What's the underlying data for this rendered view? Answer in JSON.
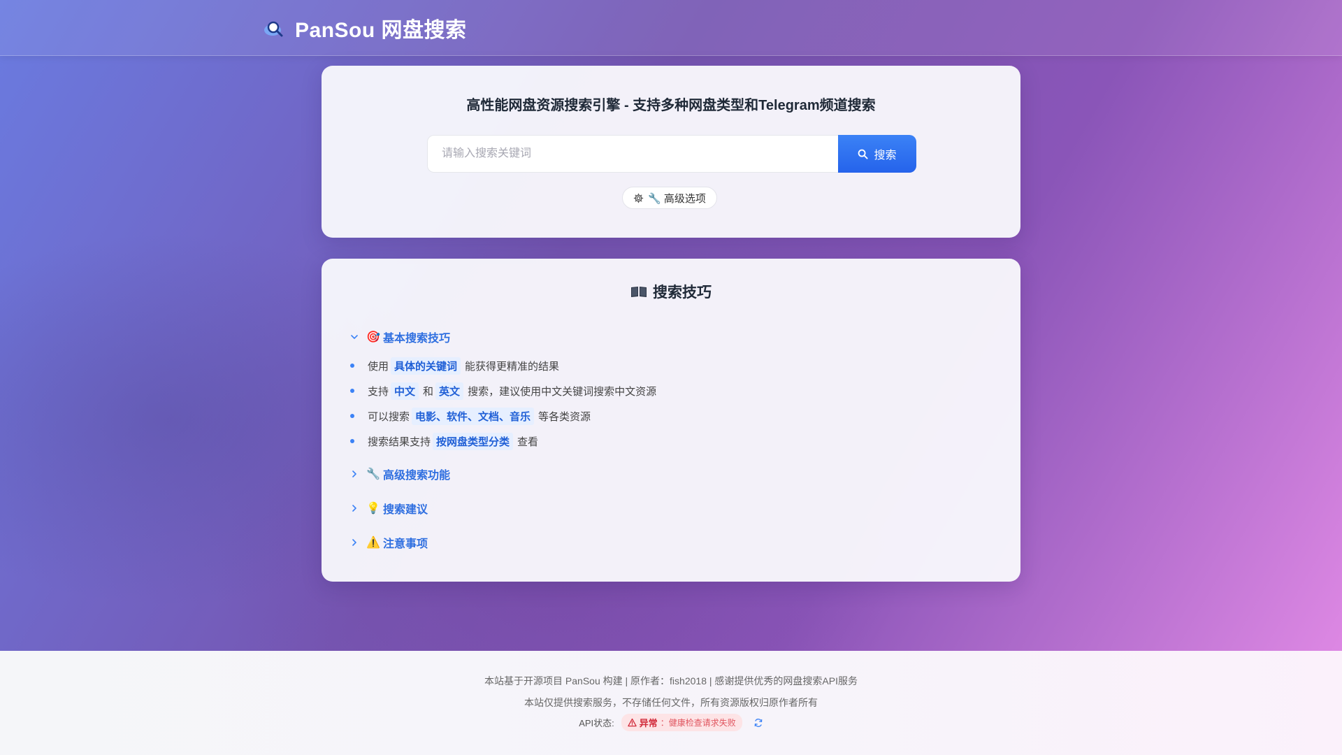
{
  "header": {
    "title": "PanSou 网盘搜索",
    "logo_icon": "magnifier-cloud-icon"
  },
  "search": {
    "subtitle": "高性能网盘资源搜索引擎 - 支持多种网盘类型和Telegram频道搜索",
    "placeholder": "请输入搜索关键词",
    "value": "",
    "button_label": "搜索",
    "advanced_label": "🔧 高级选项"
  },
  "tips": {
    "title": "搜索技巧",
    "sections": [
      {
        "emoji": "🎯",
        "label": "基本搜索技巧",
        "expanded": true
      },
      {
        "emoji": "🔧",
        "label": "高级搜索功能",
        "expanded": false
      },
      {
        "emoji": "💡",
        "label": "搜索建议",
        "expanded": false
      },
      {
        "emoji": "⚠️",
        "label": "注意事项",
        "expanded": false
      }
    ],
    "items": [
      {
        "pre": "使用",
        "highlight": "具体的关键词",
        "post": "能获得更精准的结果"
      },
      {
        "pre": "支持",
        "highlight": "中文",
        "mid": "和",
        "highlight2": "英文",
        "post": "搜索，建议使用中文关键词搜索中文资源"
      },
      {
        "pre": "可以搜索",
        "highlight": "电影、软件、文档、音乐",
        "post": "等各类资源"
      },
      {
        "pre": "搜索结果支持",
        "highlight": "按网盘类型分类",
        "post": "查看"
      }
    ]
  },
  "footer": {
    "line1": "本站基于开源项目 PanSou 构建 | 原作者：fish2018 | 感谢提供优秀的网盘搜索API服务",
    "line2": "本站仅提供搜索服务，不存储任何文件，所有资源版权归原作者所有",
    "api_label": "API状态:",
    "api_status": "异常",
    "api_detail": "：健康检查请求失败"
  },
  "colors": {
    "accent": "#2563eb",
    "link": "#2f6fe0",
    "error": "#d12a3a"
  }
}
